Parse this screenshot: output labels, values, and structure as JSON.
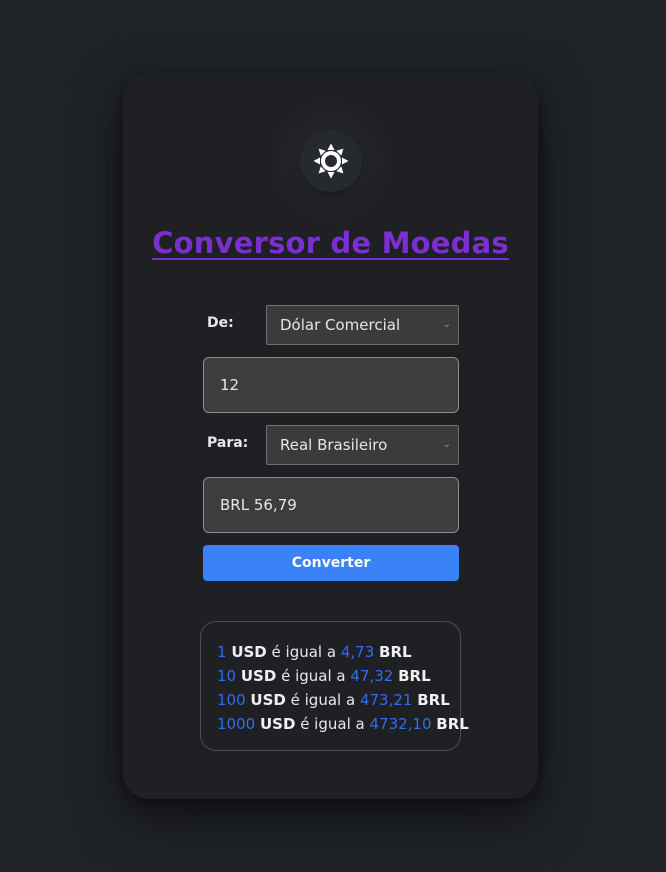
{
  "title": "Conversor de Moedas",
  "theme_toggle": {
    "icon": "sun-icon"
  },
  "from": {
    "label": "De:",
    "selected": "Dólar Comercial",
    "amount": "12"
  },
  "to": {
    "label": "Para:",
    "selected": "Real Brasileiro",
    "result": "BRL 56,79"
  },
  "convert_button": "Converter",
  "results": [
    {
      "amount": "1",
      "from_cur": "USD",
      "text": "é igual a",
      "value": "4,73",
      "to_cur": "BRL"
    },
    {
      "amount": "10",
      "from_cur": "USD",
      "text": "é igual a",
      "value": "47,32",
      "to_cur": "BRL"
    },
    {
      "amount": "100",
      "from_cur": "USD",
      "text": "é igual a",
      "value": "473,21",
      "to_cur": "BRL"
    },
    {
      "amount": "1000",
      "from_cur": "USD",
      "text": "é igual a",
      "value": "4732,10",
      "to_cur": "BRL"
    }
  ],
  "colors": {
    "title": "#7b2fcf",
    "accent": "#3b82f6",
    "number": "#2f6ef2"
  }
}
